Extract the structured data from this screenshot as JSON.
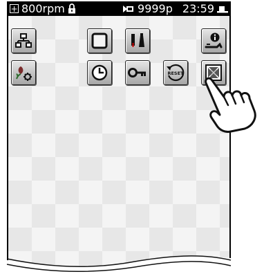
{
  "status_bar": {
    "speed": "800rpm",
    "stitch_count": "9999p",
    "time": "23:59"
  },
  "icons": {
    "expand": "plus-box-icon",
    "lock": "padlock-icon",
    "bobbin": "bobbin-counter-icon",
    "battery": "battery-icon"
  },
  "buttons": [
    {
      "name": "network-button",
      "icon": "network-icon"
    },
    {
      "name": "frame-button",
      "icon": "square-frame-icon"
    },
    {
      "name": "needle-presser-button",
      "icon": "needle-presser-icon"
    },
    {
      "name": "info-settings-button",
      "icon": "info-wrench-icon"
    },
    {
      "name": "tension-settings-button",
      "icon": "flower-gear-icon"
    },
    {
      "name": "timer-button",
      "icon": "clock-icon"
    },
    {
      "name": "key-lock-button",
      "icon": "key-icon"
    },
    {
      "name": "reset-button",
      "icon": "reset-icon",
      "label": "RESET"
    },
    {
      "name": "pattern-grid-button",
      "icon": "pattern-grid-icon"
    }
  ],
  "colors": {
    "status_bg": "#000000",
    "status_fg": "#ffffff",
    "button_bg": "#c8c8c8",
    "pattern_bg": "#f4f4f4"
  }
}
